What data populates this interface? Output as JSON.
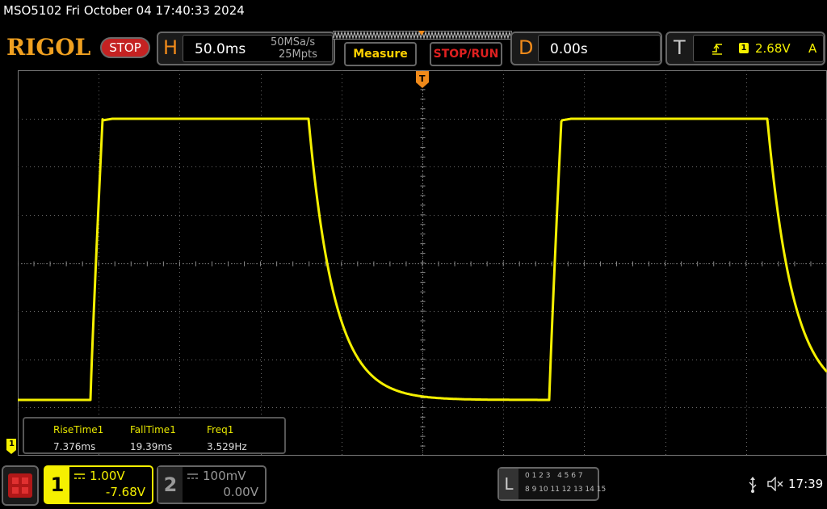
{
  "title_bar": {
    "text": "MSO5102  Fri October 04 17:40:33 2024"
  },
  "brand": {
    "logo": "RIGOL",
    "status": "STOP"
  },
  "horizontal": {
    "letter": "H",
    "timebase": "50.0ms",
    "sample_rate": "50MSa/s",
    "memory_depth": "25Mpts"
  },
  "buttons": {
    "measure": "Measure",
    "stop_run": "STOP/RUN"
  },
  "delay": {
    "letter": "D",
    "value": "0.00s"
  },
  "trigger": {
    "letter": "T",
    "source": "1",
    "level": "2.68V",
    "mode": "A",
    "marker": "T"
  },
  "channel1_marker": "1",
  "measurements": [
    {
      "label": "RiseTime1",
      "value": "7.376ms"
    },
    {
      "label": "FallTime1",
      "value": "19.39ms"
    },
    {
      "label": "Freq1",
      "value": "3.529Hz"
    }
  ],
  "channels": [
    {
      "number": "1",
      "coupling": "DC",
      "scale": "1.00V",
      "offset": "-7.68V",
      "active": true
    },
    {
      "number": "2",
      "coupling": "DC",
      "scale": "100mV",
      "offset": "0.00V",
      "active": false
    }
  ],
  "logic": {
    "letter": "L",
    "row1": "0 1 2 3   4 5 6 7",
    "row2": "8 9 10 11 12 13 14 15"
  },
  "status_bar": {
    "time": "17:39"
  },
  "colors": {
    "ch1": "#f5f000",
    "accent": "#f08a1a",
    "stop": "#c42222",
    "grid": "#8a8a8a"
  },
  "waveform": {
    "period_divisions": 5.67,
    "high_level_fraction": 0.833,
    "low_level_fraction": 0.0,
    "rise_divisions": 0.15,
    "fall_time_constant_divisions": 0.32
  }
}
